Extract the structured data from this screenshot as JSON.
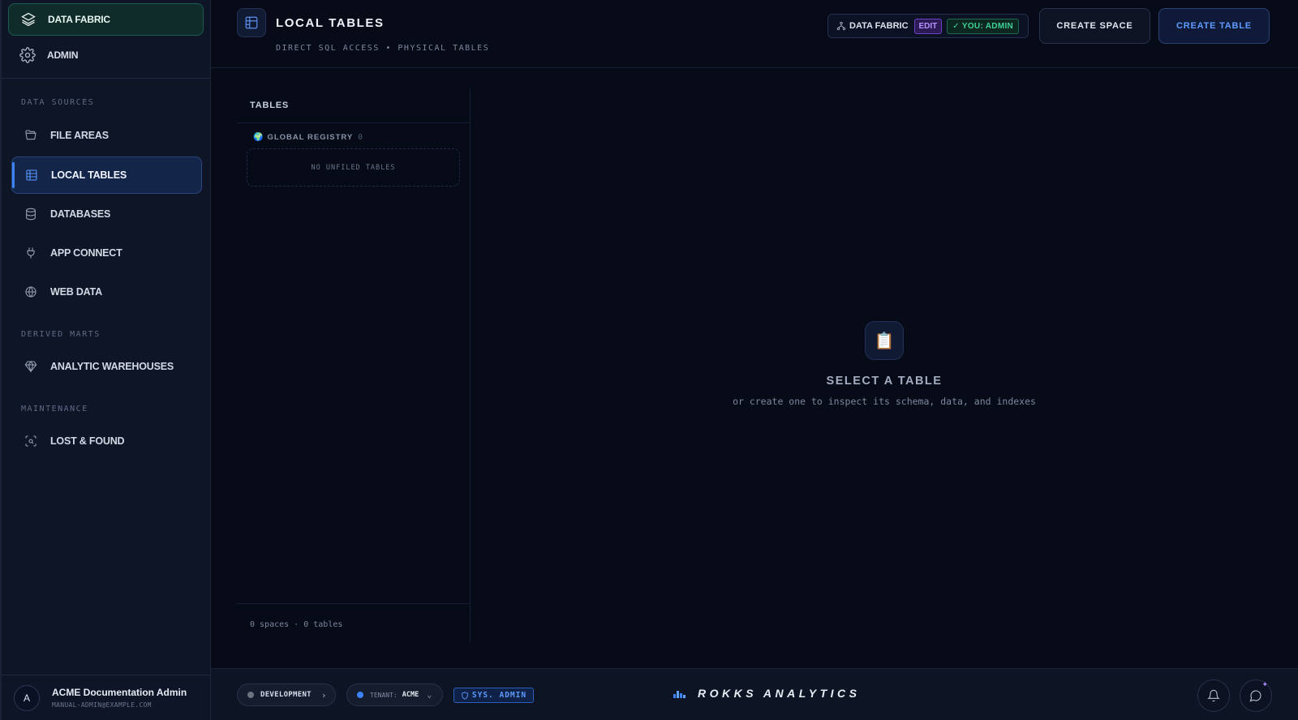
{
  "sidebar": {
    "top": [
      {
        "label": "DATA FABRIC",
        "icon": "layers-icon"
      },
      {
        "label": "ADMIN",
        "icon": "gear-icon"
      }
    ],
    "sections": {
      "data_sources": "DATA SOURCES",
      "derived_marts": "DERIVED MARTS",
      "maintenance": "MAINTENANCE"
    },
    "items": [
      {
        "label": "FILE AREAS",
        "icon": "folder-icon"
      },
      {
        "label": "LOCAL TABLES",
        "icon": "table-icon"
      },
      {
        "label": "DATABASES",
        "icon": "database-icon"
      },
      {
        "label": "APP CONNECT",
        "icon": "plug-icon"
      },
      {
        "label": "WEB DATA",
        "icon": "globe-icon"
      },
      {
        "label": "ANALYTIC WAREHOUSES",
        "icon": "gem-icon"
      },
      {
        "label": "LOST & FOUND",
        "icon": "scan-icon"
      }
    ],
    "user": {
      "initial": "A",
      "name": "ACME Documentation Admin",
      "email": "MANUAL-ADMIN@EXAMPLE.COM"
    }
  },
  "header": {
    "title": "LOCAL TABLES",
    "subtitle": "DIRECT SQL ACCESS • PHYSICAL TABLES",
    "fabric_label": "DATA FABRIC",
    "edit_badge": "EDIT",
    "role_badge": "YOU: ADMIN",
    "create_space": "CREATE SPACE",
    "create_table": "CREATE TABLE"
  },
  "tables_panel": {
    "heading": "TABLES",
    "registry_label": "GLOBAL REGISTRY",
    "registry_count": "0",
    "registry_emoji": "🌍",
    "unfiled": "NO UNFILED TABLES",
    "footer": "0 spaces · 0 tables"
  },
  "empty_state": {
    "emoji": "📋",
    "title": "SELECT A TABLE",
    "subtitle": "or create one to inspect its schema, data, and indexes"
  },
  "footer": {
    "environment": "DEVELOPMENT",
    "tenant_label": "TENANT:",
    "tenant_value": "ACME",
    "sys_badge": "SYS. ADMIN",
    "brand": "ROKKS ANALYTICS"
  },
  "colors": {
    "accent": "#3b82f6",
    "success": "#3fd39a",
    "edit": "#b792ff",
    "env_dot": "#6b7280",
    "tenant_dot": "#3b82f6"
  }
}
